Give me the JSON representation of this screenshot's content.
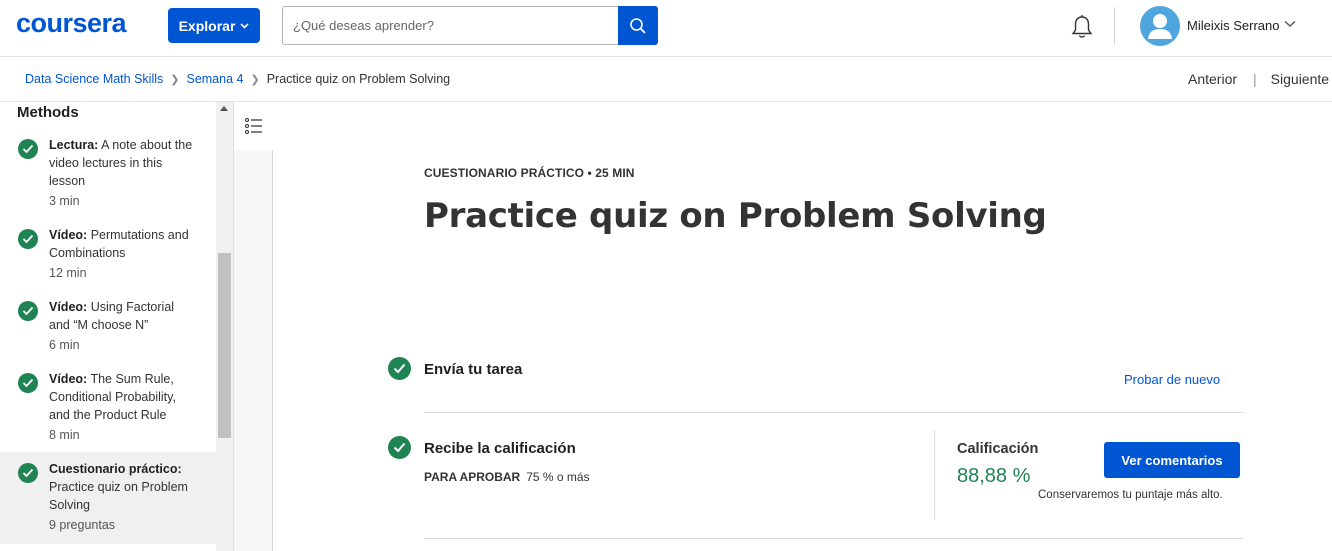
{
  "header": {
    "logo": "coursera",
    "explore_label": "Explorar",
    "search_placeholder": "¿Qué deseas aprender?",
    "user_name": "Mileixis Serrano"
  },
  "breadcrumb": {
    "items": [
      "Data Science Math Skills",
      "Semana 4",
      "Practice quiz on Problem Solving"
    ],
    "prev_label": "Anterior",
    "next_label": "Siguiente"
  },
  "sidebar": {
    "section_title": "Methods",
    "items": [
      {
        "type": "Lectura:",
        "title": "A note about the video lectures in this lesson",
        "meta": "3 min",
        "completed": true,
        "active": false
      },
      {
        "type": "Vídeo:",
        "title": "Permutations and Combinations",
        "meta": "12 min",
        "completed": true,
        "active": false
      },
      {
        "type": "Vídeo:",
        "title": "Using Factorial and “M choose N”",
        "meta": "6 min",
        "completed": true,
        "active": false
      },
      {
        "type": "Vídeo:",
        "title": "The Sum Rule, Conditional Probability, and the Product Rule",
        "meta": "8 min",
        "completed": true,
        "active": false
      },
      {
        "type": "Cuestionario práctico:",
        "title": "Practice quiz on Problem Solving",
        "meta": "9 preguntas",
        "completed": true,
        "active": true
      }
    ]
  },
  "main": {
    "kicker": "CUESTIONARIO PRÁCTICO • 25 MIN",
    "title": "Practice quiz on Problem Solving",
    "step1": {
      "title": "Envía tu tarea",
      "link": "Probar de nuevo"
    },
    "step2": {
      "title": "Recibe la calificación",
      "pass_label": "PARA APROBAR",
      "pass_value": "75 % o más",
      "grade_label": "Calificación",
      "grade_value": "88,88 %",
      "button": "Ver comentarios",
      "note": "Conservaremos tu puntaje más alto."
    }
  },
  "colors": {
    "brand": "#0056d2",
    "success": "#1f8354"
  }
}
